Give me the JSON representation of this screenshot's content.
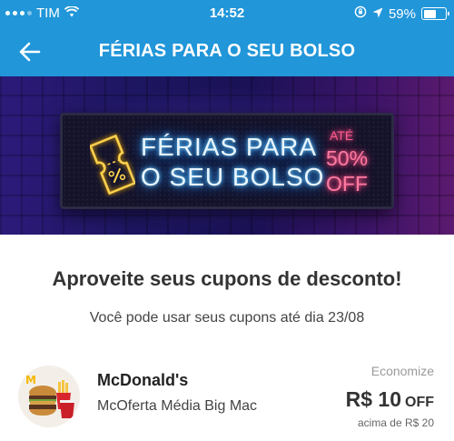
{
  "status_bar": {
    "carrier": "TIM",
    "time": "14:52",
    "battery": "59%",
    "battery_level": 0.59,
    "icons": [
      "signal-dots-icon",
      "wifi-icon",
      "orientation-lock-icon",
      "location-arrow-icon",
      "battery-icon"
    ]
  },
  "navbar": {
    "title": "FÉRIAS PARA O SEU BOLSO",
    "back_icon": "back-arrow-icon"
  },
  "banner": {
    "line1": "FÉRIAS PARA",
    "line2": "O SEU BOLSO",
    "ate": "ATÉ",
    "percent": "50%",
    "off": "OFF",
    "icon": "ticket-percent-icon",
    "colors": {
      "neon_blue": "#6fd0ff",
      "neon_pink": "#ff5b8d",
      "ticket_yellow": "#ffd34d"
    }
  },
  "content": {
    "headline": "Aproveite seus cupons de desconto!",
    "subtitle": "Você pode usar seus cupons até dia 23/08"
  },
  "coupon": {
    "brand": "McDonald's",
    "product": "McOferta Média Big Mac",
    "economize_label": "Economize",
    "amount": "R$ 10",
    "off_label": "OFF",
    "minimum": "acima de R$ 20",
    "logo_icon": "mcdonalds-combo-image"
  },
  "theme": {
    "primary": "#2196d9",
    "text_dark": "#333333"
  }
}
